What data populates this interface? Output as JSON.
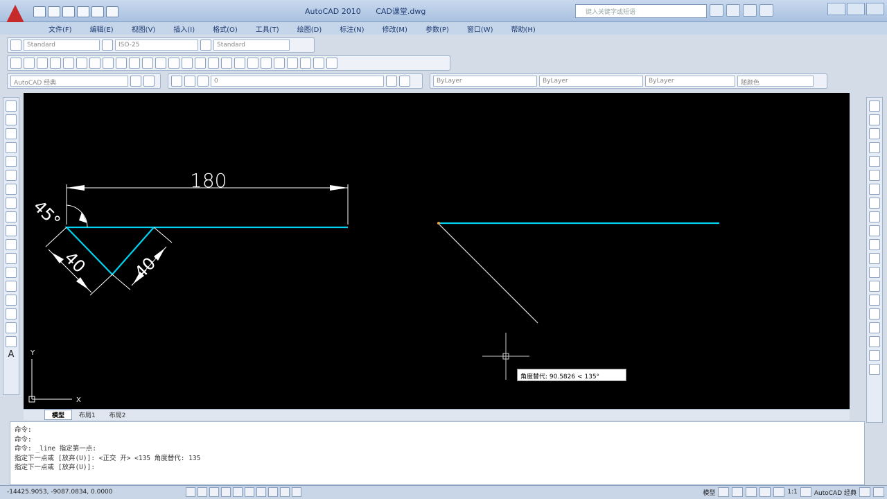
{
  "title": {
    "app": "AutoCAD 2010",
    "file": "CAD课堂.dwg"
  },
  "search": {
    "placeholder": "键入关键字或短语"
  },
  "menu": [
    {
      "label": "文件(F)"
    },
    {
      "label": "编辑(E)"
    },
    {
      "label": "视图(V)"
    },
    {
      "label": "插入(I)"
    },
    {
      "label": "格式(O)"
    },
    {
      "label": "工具(T)"
    },
    {
      "label": "绘图(D)"
    },
    {
      "label": "标注(N)"
    },
    {
      "label": "修改(M)"
    },
    {
      "label": "参数(P)"
    },
    {
      "label": "窗口(W)"
    },
    {
      "label": "帮助(H)"
    }
  ],
  "styles": {
    "text_style": "Standard",
    "dim_style": "ISO-25",
    "table_style": "Standard"
  },
  "workspace": "AutoCAD 经典",
  "layer": {
    "current": "0"
  },
  "properties": {
    "color": "ByLayer",
    "linetype": "ByLayer",
    "lineweight": "ByLayer",
    "plotstyle": "随颜色"
  },
  "canvas": {
    "dim_180": "180",
    "dim_45": "45°",
    "dim_40a": "40",
    "dim_40b": "40",
    "ucs_x": "X",
    "ucs_y": "Y",
    "tooltip": "角度替代: 90.5826 < 135°",
    "colors": {
      "background": "#000000",
      "geometry": "#00d2f0",
      "dimension": "#ffffff"
    }
  },
  "tabs": [
    {
      "label": "模型",
      "active": true
    },
    {
      "label": "布局1",
      "active": false
    },
    {
      "label": "布局2",
      "active": false
    }
  ],
  "command_lines": [
    "命令:",
    "命令:",
    "命令: _line 指定第一点:",
    "指定下一点或 [放弃(U)]: <正交 开> <135 角度替代: 135",
    "指定下一点或 [放弃(U)]:"
  ],
  "status": {
    "coords": "-14425.9053, -9087.0834, 0.0000",
    "model_label": "模型",
    "scale": "1:1",
    "workspace": "AutoCAD 经典"
  }
}
